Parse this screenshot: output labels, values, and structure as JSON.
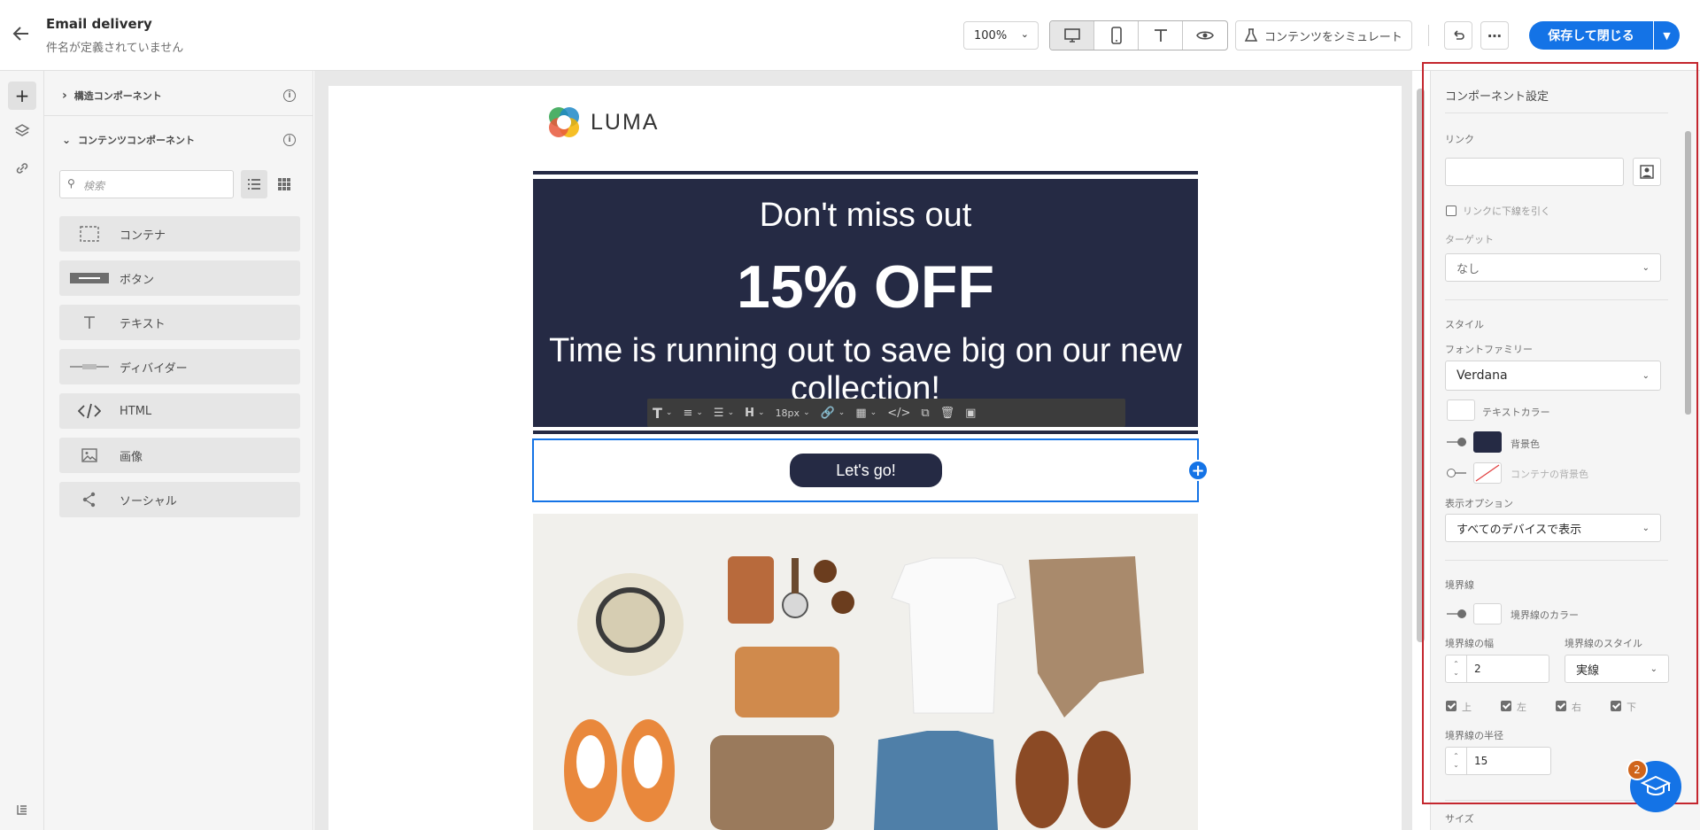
{
  "header": {
    "title": "Email delivery",
    "subtitle": "件名が定義されていません",
    "zoom": "100%",
    "simulate_label": "コンテンツをシミュレート",
    "save_label": "保存して閉じる"
  },
  "left_panel": {
    "structure_title": "構造コンポーネント",
    "content_title": "コンテンツコンポーネント",
    "search_placeholder": "検索",
    "components": [
      {
        "label": "コンテナ",
        "icon": "container-icon"
      },
      {
        "label": "ボタン",
        "icon": "button-icon"
      },
      {
        "label": "テキスト",
        "icon": "text-icon"
      },
      {
        "label": "ディバイダー",
        "icon": "divider-icon"
      },
      {
        "label": "HTML",
        "icon": "html-icon"
      },
      {
        "label": "画像",
        "icon": "image-icon"
      },
      {
        "label": "ソーシャル",
        "icon": "social-icon"
      }
    ]
  },
  "email": {
    "logo_text": "LUMA",
    "headline": "Don't miss out",
    "offer": "15% OFF",
    "body": "Time is running out to save big on our new collection!",
    "cta": "Let's go!",
    "toolbar_font_size": "18px",
    "brand_color": "#252a44"
  },
  "right_panel": {
    "title": "コンポーネント設定",
    "link_label": "リンク",
    "underline_label": "リンクに下線を引く",
    "target_label": "ターゲット",
    "target_value": "なし",
    "style_label": "スタイル",
    "font_family_label": "フォントファミリー",
    "font_family_value": "Verdana",
    "text_color_label": "テキストカラー",
    "bg_color_label": "背景色",
    "container_bg_label": "コンテナの背景色",
    "display_label": "表示オプション",
    "display_value": "すべてのデバイスで表示",
    "border_label": "境界線",
    "border_color_label": "境界線のカラー",
    "border_width_label": "境界線の幅",
    "border_width_value": "2",
    "border_style_label": "境界線のスタイル",
    "border_style_value": "実線",
    "side_top": "上",
    "side_left": "左",
    "side_right": "右",
    "side_bottom": "下",
    "radius_label": "境界線の半径",
    "radius_value": "15",
    "size_label": "サイズ",
    "bg_color": "#252a44"
  },
  "help_badge": "2"
}
